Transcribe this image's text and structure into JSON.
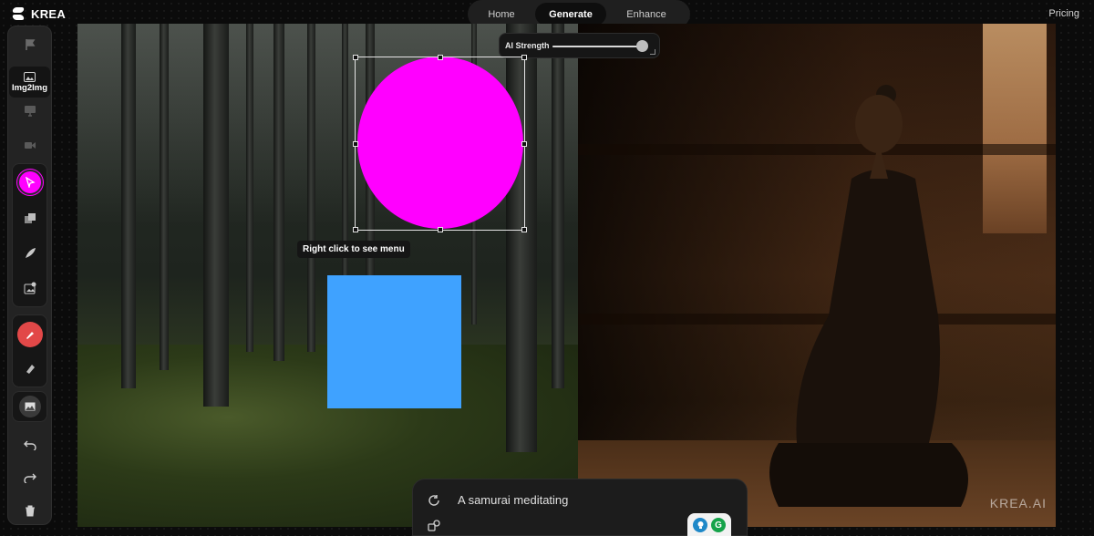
{
  "app": {
    "name": "KREA"
  },
  "nav": {
    "tabs": [
      "Home",
      "Generate",
      "Enhance"
    ],
    "active": "Generate"
  },
  "header": {
    "pricing_label": "Pricing"
  },
  "toolbar": {
    "img2img_label": "Img2Img"
  },
  "canvas": {
    "ai_strength": {
      "label": "AI Strength",
      "value": 0.95
    },
    "tooltip": "Right click to see menu",
    "watermark": "KREA.AI",
    "shapes": [
      {
        "type": "circle",
        "color": "#ff00ff",
        "selected": true
      },
      {
        "type": "rectangle",
        "color": "#3fa2ff",
        "selected": false
      }
    ]
  },
  "prompt": {
    "text": "A samurai meditating"
  },
  "colors": {
    "tool_active": "#ff00ff",
    "tool_brush": "#e24848",
    "tooltip_bg": "#151515"
  }
}
